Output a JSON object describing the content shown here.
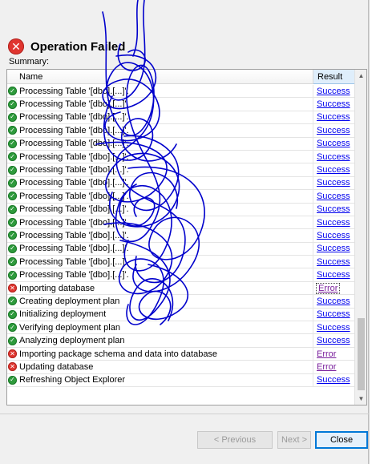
{
  "dialog": {
    "title": "Operation Failed",
    "summary_label": "Summary:"
  },
  "table": {
    "columns": {
      "name": "Name",
      "result": "Result"
    },
    "rows": [
      {
        "name": "Processing Table '[dbo].[...]'.",
        "status": "success",
        "result": "Success"
      },
      {
        "name": "Processing Table '[dbo].[...]'.",
        "status": "success",
        "result": "Success"
      },
      {
        "name": "Processing Table '[dbo].[...]'.",
        "status": "success",
        "result": "Success"
      },
      {
        "name": "Processing Table '[dbo].[...]'.",
        "status": "success",
        "result": "Success"
      },
      {
        "name": "Processing Table '[dbo].[...]'.",
        "status": "success",
        "result": "Success"
      },
      {
        "name": "Processing Table '[dbo].[...]'.",
        "status": "success",
        "result": "Success"
      },
      {
        "name": "Processing Table '[dbo].[...]'.",
        "status": "success",
        "result": "Success"
      },
      {
        "name": "Processing Table '[dbo].[...]'.",
        "status": "success",
        "result": "Success"
      },
      {
        "name": "Processing Table '[dbo].[...]'.",
        "status": "success",
        "result": "Success"
      },
      {
        "name": "Processing Table '[dbo].[...]'.",
        "status": "success",
        "result": "Success"
      },
      {
        "name": "Processing Table '[dbo].[...]'.",
        "status": "success",
        "result": "Success"
      },
      {
        "name": "Processing Table '[dbo].[...]'.",
        "status": "success",
        "result": "Success"
      },
      {
        "name": "Processing Table '[dbo].[...]'.",
        "status": "success",
        "result": "Success"
      },
      {
        "name": "Processing Table '[dbo].[...]'.",
        "status": "success",
        "result": "Success"
      },
      {
        "name": "Processing Table '[dbo].[...]'.",
        "status": "success",
        "result": "Success"
      },
      {
        "name": "Importing database",
        "status": "error",
        "result": "Error"
      },
      {
        "name": "Creating deployment plan",
        "status": "success",
        "result": "Success"
      },
      {
        "name": "Initializing deployment",
        "status": "success",
        "result": "Success"
      },
      {
        "name": "Verifying deployment plan",
        "status": "success",
        "result": "Success"
      },
      {
        "name": "Analyzing deployment plan",
        "status": "success",
        "result": "Success"
      },
      {
        "name": "Importing package schema and data into database",
        "status": "error",
        "result": "Error"
      },
      {
        "name": "Updating database",
        "status": "error",
        "result": "Error"
      },
      {
        "name": "Refreshing Object Explorer",
        "status": "success",
        "result": "Success"
      }
    ]
  },
  "buttons": {
    "previous": "< Previous",
    "next": "Next >",
    "close": "Close"
  },
  "colors": {
    "success_icon": "#2e9b3c",
    "error_icon": "#e0352f",
    "link": "#0000ee",
    "scribble": "#0000cc"
  },
  "icons": {
    "header": "error-icon",
    "row_success": "check-circle-icon",
    "row_error": "error-circle-icon"
  }
}
